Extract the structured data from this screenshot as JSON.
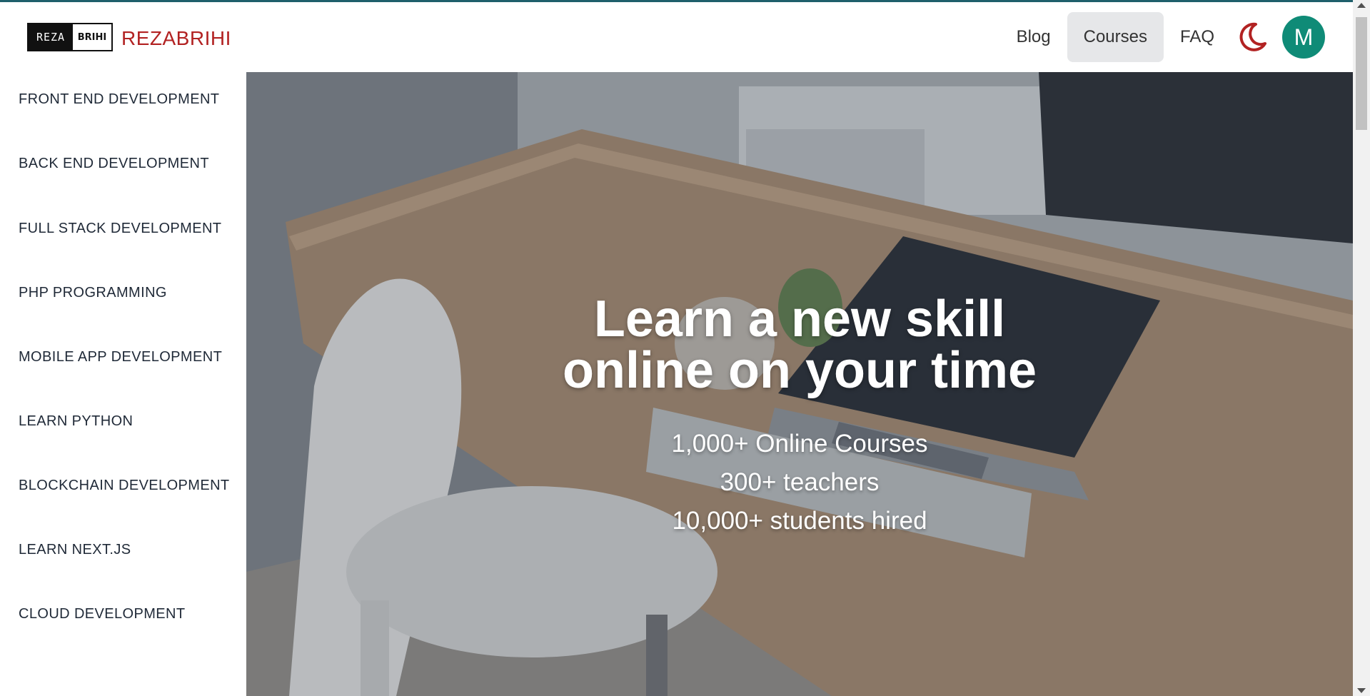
{
  "brand": {
    "logo_left": "REZA",
    "logo_right": "BRIHI",
    "name": "REZABRIHI"
  },
  "nav": {
    "links": [
      "Blog",
      "Courses",
      "FAQ"
    ],
    "active": "Courses",
    "avatar_initial": "M"
  },
  "sidebar": {
    "items": [
      "FRONT END DEVELOPMENT",
      "BACK END DEVELOPMENT",
      "FULL STACK DEVELOPMENT",
      "PHP PROGRAMMING",
      "MOBILE APP DEVELOPMENT",
      "LEARN PYTHON",
      "BLOCKCHAIN DEVELOPMENT",
      "LEARN NEXT.JS",
      "CLOUD DEVELOPMENT"
    ]
  },
  "hero": {
    "title_line1": "Learn a new skill",
    "title_line2": "online on your time",
    "stats": [
      "1,000+ Online Courses",
      "300+ teachers",
      "10,000+ students hired"
    ]
  },
  "icons": {
    "theme_toggle": "moon-icon",
    "accent_color": "#b22222",
    "avatar_color": "#0f8b77"
  }
}
